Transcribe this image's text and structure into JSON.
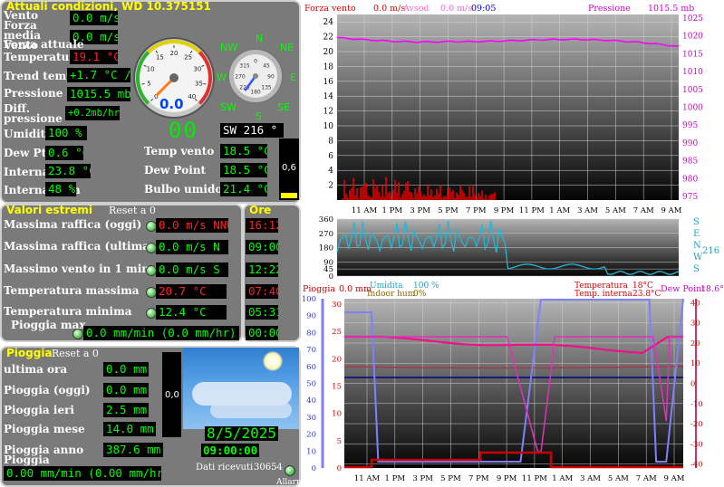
{
  "current": {
    "title": "Attuali condizioni, WD 10.375151",
    "rows": [
      {
        "label": "Vento",
        "value": "0.0 m/s",
        "color": "#00ff00"
      },
      {
        "label": "Forza media Vento",
        "value": "0.0 m/s",
        "color": "#00ff00"
      },
      {
        "label": "Forza attuale",
        "value": "",
        "color": "#00ff00"
      },
      {
        "label": "Temperatura",
        "value": "19.1 °C",
        "color": "#ff2222"
      },
      {
        "label": "Trend temp",
        "value": "+1.7 °C /hr",
        "color": "#00ff00"
      },
      {
        "label": "Pressione",
        "value": "1015.5 mb",
        "color": "#00ff00"
      },
      {
        "label": "Diff. pressione",
        "value": "+0.2mb/hr",
        "color": "#00ff00"
      },
      {
        "label": "Umidita",
        "value": "100 %",
        "color": "#00ff00"
      },
      {
        "label": "Dew Pt Depr.",
        "value": "0.6 °C",
        "color": "#00ff00"
      },
      {
        "label": "Interna temp.",
        "value": "23.8 °C",
        "color": "#00ff00"
      },
      {
        "label": "Interna hum",
        "value": "48 %",
        "color": "#00ff00"
      }
    ],
    "right_rows": [
      {
        "label": "Temp vento",
        "value": "18.5 °C"
      },
      {
        "label": "Dew Point",
        "value": "18.5 °C"
      },
      {
        "label": "Bulbo umido",
        "value": "21.4 °C"
      }
    ],
    "speed_gauge": {
      "value": "0.0",
      "ticks": [
        "0",
        "5",
        "10",
        "15",
        "20",
        "25",
        "30",
        "35",
        "40"
      ],
      "level": 0
    },
    "compass": {
      "labels": [
        "N",
        "NE",
        "E",
        "SE",
        "S",
        "SW",
        "W",
        "NW"
      ],
      "degree_ticks": [
        "0",
        "45",
        "90",
        "135",
        "180",
        "225",
        "270",
        "315"
      ],
      "direction_deg": 216
    },
    "digital_dir": "00",
    "wind_dir_text": "SW  216 °",
    "rain_bar_value": "0,6",
    "rain_bar_level": 0.1
  },
  "extremes": {
    "title": "Valori estremi",
    "reset": "Reset a 0",
    "ore_title": "Ore",
    "rows": [
      {
        "label": "Massima raffica (oggi)",
        "value": "0.0 m/s NNW",
        "time": "16:12",
        "value_color": "red",
        "time_color": "red"
      },
      {
        "label": "Massima raffica (ultima ora)",
        "value": "0.0 m/s  N",
        "time": "09:00",
        "value_color": "green",
        "time_color": "green"
      },
      {
        "label": "Massimo vento in 1 minuto",
        "value": "0.0 m/s   S",
        "time": "12:22",
        "value_color": "green",
        "time_color": "green"
      },
      {
        "label": "Temperatura massima",
        "value": "20.7 °C",
        "time": "07:40",
        "value_color": "red",
        "time_color": "red"
      },
      {
        "label": "Temperatura minima",
        "value": "12.4 °C",
        "time": "05:31",
        "value_color": "green",
        "time_color": "green"
      },
      {
        "label": "Pioggia max",
        "value": "0.0 mm/min (0.0 mm/hr)",
        "time": "00:00",
        "value_color": "green",
        "time_color": "green"
      }
    ]
  },
  "rain": {
    "title": "Pioggia",
    "reset": "Reset a 0",
    "rows": [
      {
        "label": "ultima ora",
        "value": "0.0 mm"
      },
      {
        "label": "Pioggia (oggi)",
        "value": "0.0 mm"
      },
      {
        "label": "Pioggia ieri",
        "value": "2.5 mm"
      },
      {
        "label": "Pioggia mese",
        "value": "14.0 mm"
      },
      {
        "label": "Pioggia anno",
        "value": "387.6 mm"
      },
      {
        "label": "Pioggia",
        "value": "0.00 mm/min (0.00 mm/hr)"
      }
    ],
    "bar_value": "0,0",
    "date": "8/5/2025",
    "time": "09:00:00",
    "dati_label": "Dati ricevuti",
    "dati_count": "30654",
    "alarm_label": "Allarme"
  },
  "charts": {
    "top": {
      "left_label": "Forza vento",
      "left_value": "0.0 m/s",
      "avg_label": "Avsod",
      "avg_value": "0.0 m/s",
      "time": "09:05",
      "right_label": "Pressione",
      "right_value": "1015.5 mb",
      "left_ticks": [
        "2",
        "4",
        "6",
        "8",
        "10",
        "12",
        "14",
        "16",
        "18",
        "20",
        "22",
        "24"
      ],
      "right_ticks": [
        "975",
        "980",
        "985",
        "990",
        "995",
        "1000",
        "1005",
        "1010",
        "1015",
        "1020",
        "1025"
      ],
      "x_ticks": [
        "11 AM",
        "1 PM",
        "3 PM",
        "5 PM",
        "7 PM",
        "9 PM",
        "11 PM",
        "1 AM",
        "3 AM",
        "5 AM",
        "7 AM",
        "9 AM"
      ],
      "colors": {
        "wind": "#ff0000",
        "pressure": "#ff00ff"
      }
    },
    "mid": {
      "left_ticks": [
        "0",
        "45",
        "90",
        "180",
        "270",
        "360"
      ],
      "right_labels": [
        "S",
        "E",
        "N",
        "W",
        "S"
      ],
      "right_value": "216",
      "bottom_label": "Umidita",
      "bottom_value": "100 %",
      "color": "#22b8d8"
    },
    "bottom": {
      "rain_label": "Pioggia",
      "rain_value": "0.0 mm",
      "indoor_label": "Indoor hum",
      "indoor_value": "0%",
      "temp_label": "Temperatura",
      "temp_value": "18°C",
      "int_label": "Temp. interna",
      "int_value": "23.8°C",
      "dew_label": "Dew Point",
      "dew_value": "18.6°C",
      "left_ticks": [
        "0",
        "10",
        "20",
        "30",
        "40",
        "50",
        "60",
        "70",
        "80",
        "90",
        "100"
      ],
      "mid_ticks": [
        "0",
        "5",
        "10",
        "15",
        "20",
        "25",
        "30"
      ],
      "right_ticks": [
        "-40",
        "-30",
        "-20",
        "-10",
        "0",
        "10",
        "20",
        "30",
        "40"
      ],
      "x_ticks": [
        "11 AM",
        "1 PM",
        "3 PM",
        "5 PM",
        "7 PM",
        "9 PM",
        "11 PM",
        "1 AM",
        "3 AM",
        "5 AM",
        "7 AM",
        "9 AM"
      ]
    }
  }
}
